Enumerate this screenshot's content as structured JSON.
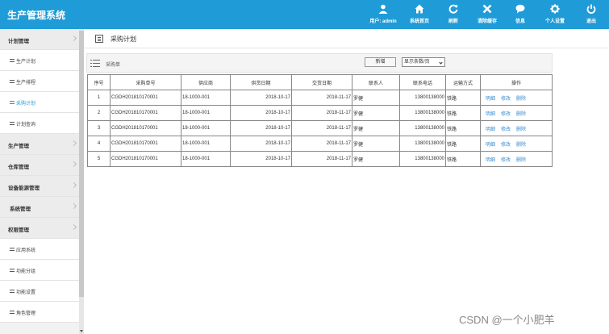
{
  "app": {
    "title": "生产管理系统"
  },
  "topnav": [
    {
      "label": "用户: admin",
      "icon": "user-icon"
    },
    {
      "label": "系统首页",
      "icon": "home-icon"
    },
    {
      "label": "刷新",
      "icon": "refresh-icon"
    },
    {
      "label": "清除缓存",
      "icon": "close-icon"
    },
    {
      "label": "信息",
      "icon": "message-icon"
    },
    {
      "label": "个人设置",
      "icon": "gear-icon"
    },
    {
      "label": "退出",
      "icon": "power-icon"
    }
  ],
  "sidebar": {
    "items": [
      {
        "label": "计划管理",
        "type": "group"
      },
      {
        "label": "生产计划",
        "type": "sub"
      },
      {
        "label": "生产排程",
        "type": "sub"
      },
      {
        "label": "采购计划",
        "type": "sub",
        "active": true
      },
      {
        "label": "计划查询",
        "type": "sub"
      },
      {
        "label": "生产管理",
        "type": "group"
      },
      {
        "label": "仓库管理",
        "type": "group"
      },
      {
        "label": "设备能源管理",
        "type": "group"
      },
      {
        "label": "系统管理",
        "type": "group"
      },
      {
        "label": "权限管理",
        "type": "group"
      },
      {
        "label": "应用系统",
        "type": "sub"
      },
      {
        "label": "功能分组",
        "type": "sub"
      },
      {
        "label": "功能设置",
        "type": "sub"
      },
      {
        "label": "角色管理",
        "type": "sub"
      }
    ]
  },
  "page": {
    "title": "采购计划"
  },
  "toolbar": {
    "panel_label": "采购单",
    "new_button": "新增",
    "page_size_select": "显示条数/页"
  },
  "table": {
    "headers": [
      "序号",
      "采购单号",
      "供应商",
      "供货日期",
      "交货日期",
      "联系人",
      "联系电话",
      "运输方式",
      "操作"
    ],
    "rows": [
      {
        "no": "1",
        "order": "CGDH201810170001",
        "supplier": "18-1000-001",
        "supply_date": "2018-10-17",
        "delivery_date": "2018-11-17",
        "contact": "罗健",
        "phone": "13800138000",
        "transport": "铁路"
      },
      {
        "no": "2",
        "order": "CGDH201810170001",
        "supplier": "18-1000-001",
        "supply_date": "2018-10-17",
        "delivery_date": "2018-11-17",
        "contact": "罗健",
        "phone": "13800138000",
        "transport": "铁路"
      },
      {
        "no": "3",
        "order": "CGDH201810170001",
        "supplier": "18-1000-001",
        "supply_date": "2018-10-17",
        "delivery_date": "2018-11-17",
        "contact": "罗健",
        "phone": "13800138000",
        "transport": "铁路"
      },
      {
        "no": "4",
        "order": "CGDH201810170001",
        "supplier": "18-1000-001",
        "supply_date": "2018-10-17",
        "delivery_date": "2018-11-17",
        "contact": "罗健",
        "phone": "13800138000",
        "transport": "铁路"
      },
      {
        "no": "5",
        "order": "CGDH201810170001",
        "supplier": "18-1000-001",
        "supply_date": "2018-10-17",
        "delivery_date": "2018-11-17",
        "contact": "罗健",
        "phone": "13800138000",
        "transport": "铁路"
      }
    ],
    "actions": [
      "明细",
      "修改",
      "删除"
    ]
  },
  "watermark": "CSDN @一个小肥羊",
  "colors": {
    "topbar": "#1f9bd8",
    "link": "#3a8ed2"
  }
}
